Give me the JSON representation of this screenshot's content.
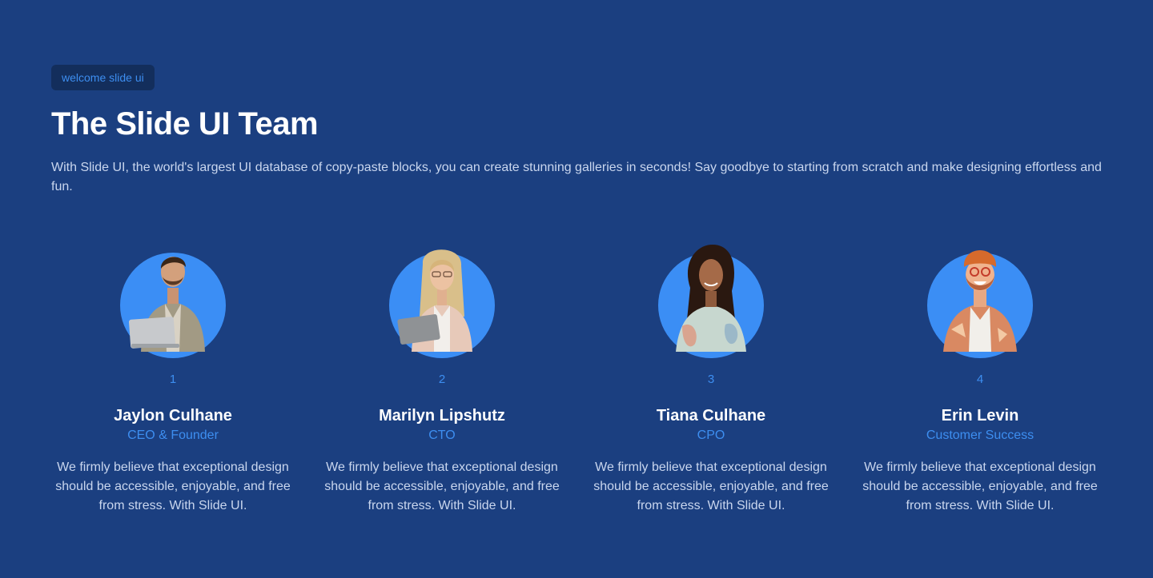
{
  "header": {
    "badge": "welcome slide ui",
    "title": "The Slide UI Team",
    "description": "With Slide UI, the world's largest UI database of copy-paste blocks, you can create stunning galleries in seconds! Say goodbye to starting from scratch and make designing effortless and fun."
  },
  "team": [
    {
      "number": "1",
      "name": "Jaylon Culhane",
      "role": "CEO & Founder",
      "bio": "We firmly believe that exceptional design should be accessible, enjoyable, and free from stress. With Slide UI."
    },
    {
      "number": "2",
      "name": "Marilyn Lipshutz",
      "role": "CTO",
      "bio": "We firmly believe that exceptional design should be accessible, enjoyable, and free from stress. With Slide UI."
    },
    {
      "number": "3",
      "name": "Tiana Culhane",
      "role": "CPO",
      "bio": "We firmly believe that exceptional design should be accessible, enjoyable, and free from stress. With Slide UI."
    },
    {
      "number": "4",
      "name": "Erin Levin",
      "role": "Customer Success",
      "bio": "We firmly believe that exceptional design should be accessible, enjoyable, and free from stress. With Slide UI."
    }
  ],
  "colors": {
    "background": "#1b3f80",
    "accent": "#3d8ef0",
    "avatar_circle": "#3b8ef5"
  }
}
